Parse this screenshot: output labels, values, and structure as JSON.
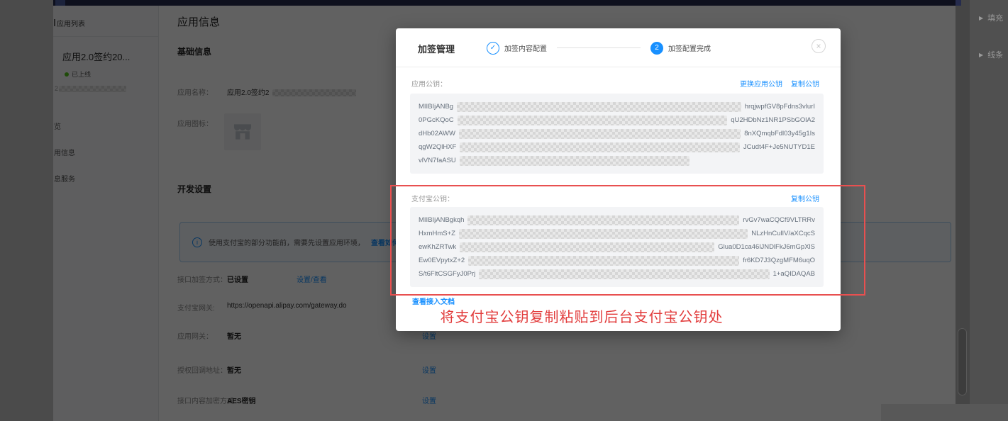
{
  "colors": {
    "accent_blue": "#1890ff",
    "red_annotation": "#e23c3c",
    "green_status": "#52c41a",
    "topbar_navy": "#252b4d"
  },
  "editor": {
    "panel_items": [
      {
        "label": "填充"
      },
      {
        "label": "线条"
      }
    ],
    "collapse_arrow": "▶"
  },
  "page": {
    "sidebar": {
      "header": "应用列表",
      "app_name": "应用2.0签约20...",
      "app_status": "已上线",
      "app_id_prefix": "2",
      "nav": [
        "览",
        "用信息",
        "息服务"
      ]
    },
    "main": {
      "title": "应用信息",
      "basic_section": "基础信息",
      "app_name_label": "应用名称：",
      "app_name_value": "应用2.0签约2",
      "app_icon_label": "应用图标：",
      "dev_section": "开发设置",
      "banner": {
        "info_icon": "i",
        "text": "使用支付宝的部分功能前，需要先设置应用环境，",
        "link": "查看如何设置"
      },
      "rows": [
        {
          "label": "接口加签方式：",
          "value": "已设置",
          "action": "设置/查看"
        },
        {
          "label": "支付宝网关:",
          "value": "https://openapi.alipay.com/gateway.do",
          "action": ""
        },
        {
          "label": "应用网关：",
          "value": "暂无",
          "action": "设置"
        },
        {
          "label": "授权回调地址：",
          "value": "暂无",
          "action": "设置"
        },
        {
          "label": "接口内容加密方式：",
          "value": "AES密钥",
          "action": "设置"
        }
      ]
    }
  },
  "modal": {
    "title": "加签管理",
    "close_icon": "×",
    "steps": [
      {
        "icon": "✓",
        "label": "加签内容配置"
      },
      {
        "number": "2",
        "label": "加签配置完成"
      }
    ],
    "app_key": {
      "label": "应用公钥：",
      "replace_link": "更换应用公钥",
      "copy_link": "复制公钥",
      "lines": [
        {
          "prefix": "MIIBIjANBg",
          "suffix": "hrqjwpfGV8pFdns3vlurI"
        },
        {
          "prefix": "0PGcKQoC",
          "suffix": "qU2HDbNz1NR1PSbGOlA2"
        },
        {
          "prefix": "dHb02AWW",
          "suffix": "8nXQmqbFdl03y45g1Is"
        },
        {
          "prefix": "qgW2QlHXF",
          "suffix": "JCudt4F+Je5NUTYD1E"
        },
        {
          "prefix": "vlVN7faASU",
          "suffix": ""
        }
      ]
    },
    "alipay_key": {
      "label": "支付宝公钥：",
      "copy_link": "复制公钥",
      "lines": [
        {
          "prefix": "MIIBIjANBgkqh",
          "suffix": "rvGv7waCQCf9VLTRRv"
        },
        {
          "prefix": "HxmHmS+Z",
          "suffix": "NLzHnCulIV/aXCqcS"
        },
        {
          "prefix": "ewKhZRTwk",
          "suffix": "Glua0D1ca46lJNDlFkJ6mGpXlS"
        },
        {
          "prefix": "Ew0EVpytxZ+2",
          "suffix": "fr6KD7J3QzgMFM6uqO"
        },
        {
          "prefix": "S/t6FltCSGFyJ0Prj",
          "suffix": "1+aQIDAQAB"
        }
      ]
    },
    "doc_link": "查看接入文档"
  },
  "annotation": {
    "note": "将支付宝公钥复制粘贴到后台支付宝公钥处"
  }
}
